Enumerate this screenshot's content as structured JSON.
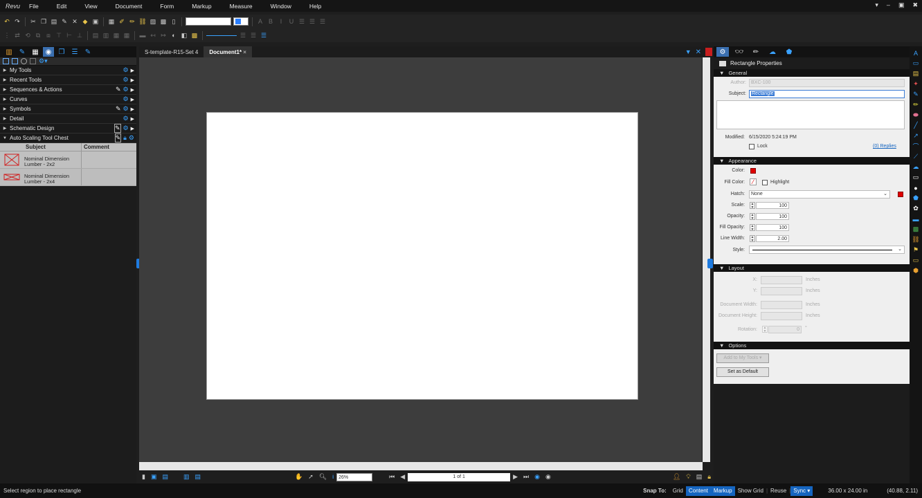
{
  "app": {
    "logo_text": "Revu",
    "menu": [
      "File",
      "Edit",
      "View",
      "Document",
      "Form",
      "Markup",
      "Measure",
      "Window",
      "Help"
    ],
    "window_controls": [
      "▾",
      "–",
      "▣",
      "✖"
    ]
  },
  "left_panel": {
    "tool_chest_sections": [
      {
        "label": "My Tools",
        "has_pen": false
      },
      {
        "label": "Recent Tools",
        "has_pen": false
      },
      {
        "label": "Sequences & Actions",
        "has_pen": true
      },
      {
        "label": "Curves",
        "has_pen": false
      },
      {
        "label": "Symbols",
        "has_pen": true
      },
      {
        "label": "Detail",
        "has_pen": false
      },
      {
        "label": "Schematic Design",
        "has_pen": true
      },
      {
        "label": "Auto Scaling Tool Chest",
        "has_pen": true,
        "expanded": true
      }
    ],
    "table": {
      "headers": {
        "subject": "Subject",
        "comment": "Comment"
      },
      "items": [
        {
          "subject": "Nominal Dimension Lumber - 2x2",
          "comment": "",
          "icon": "rectangle-cross-icon"
        },
        {
          "subject": "Nominal Dimension Lumber - 2x4",
          "comment": "",
          "icon": "flat-rectangle-cross-icon"
        }
      ]
    }
  },
  "tabs": [
    {
      "label": "S-template-R15-Set 4",
      "active": false
    },
    {
      "label": "Document1*",
      "active": true,
      "close": "×"
    }
  ],
  "bottom_nav": {
    "zoom": "26%",
    "page": "1 of 1"
  },
  "properties": {
    "title": "Rectangle Properties",
    "general": {
      "header": "General",
      "author_label": "Author:",
      "author_value": "BXC-100",
      "subject_label": "Subject:",
      "subject_value": "Rectangle",
      "modified_label": "Modified:",
      "modified_value": "6/15/2020 5:24:19 PM",
      "lock_label": "Lock",
      "replies_label": "(0) Replies"
    },
    "appearance": {
      "header": "Appearance",
      "color_label": "Color:",
      "fill_color_label": "Fill Color:",
      "highlight_label": "Highlight",
      "hatch_label": "Hatch:",
      "hatch_value": "None",
      "scale_label": "Scale:",
      "scale_value": "100",
      "opacity_label": "Opacity:",
      "opacity_value": "100",
      "fill_opacity_label": "Fill Opacity:",
      "fill_opacity_value": "100",
      "line_width_label": "Line Width:",
      "line_width_value": "2.00",
      "style_label": "Style:",
      "color_hex": "#e00000"
    },
    "layout": {
      "header": "Layout",
      "x_label": "X:",
      "y_label": "Y:",
      "unit": "Inches",
      "doc_width_label": "Document Width:",
      "doc_height_label": "Document Height:",
      "rotation_label": "Rotation:",
      "rotation_value": "0",
      "degree": "°"
    },
    "options": {
      "header": "Options",
      "add_button": "Add to My Tools",
      "default_button": "Set as Default"
    }
  },
  "status": {
    "message": "Select region to place rectangle",
    "snap_label": "Snap To:",
    "snap_options": [
      {
        "label": "Grid",
        "on": false
      },
      {
        "label": "Content",
        "on": true
      },
      {
        "label": "Markup",
        "on": true
      },
      {
        "label": "Show Grid",
        "on": false
      },
      {
        "label": "Reuse",
        "on": false
      },
      {
        "label": "Sync",
        "on": true
      }
    ],
    "dimensions": "36.00 x 24.00 in",
    "coordinates": "(40.88, 2.11)"
  },
  "colors": {
    "accent": "#1565c0",
    "highlight_blue": "#3aa2ff",
    "markup_red": "#e00000"
  }
}
